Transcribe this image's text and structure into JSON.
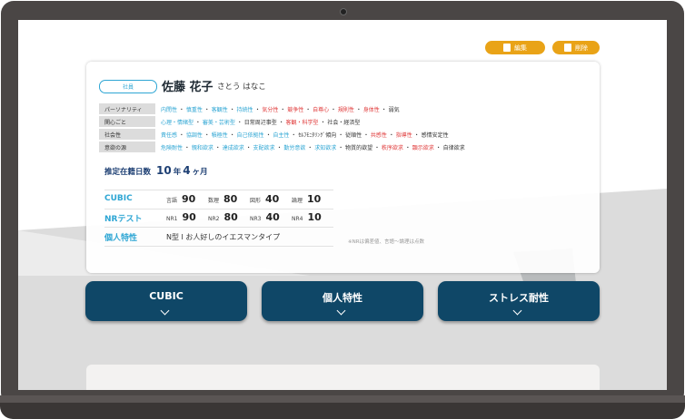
{
  "toolbar": {
    "edit_label": "編集",
    "delete_label": "削除"
  },
  "employee": {
    "badge": "社員",
    "name": "佐藤 花子",
    "kana": "さとう はなこ"
  },
  "tags": [
    {
      "label": "パーソナリティ",
      "values": [
        {
          "text": "内閉性",
          "color": "blue"
        },
        {
          "text": "慎重性",
          "color": "blue"
        },
        {
          "text": "客観性",
          "color": "blue"
        },
        {
          "text": "持続性",
          "color": "blue"
        },
        {
          "text": "気分性",
          "color": "red"
        },
        {
          "text": "競争性",
          "color": "red"
        },
        {
          "text": "自尊心",
          "color": "red"
        },
        {
          "text": "規則性",
          "color": "red"
        },
        {
          "text": "身体性",
          "color": "red"
        },
        {
          "text": "弱気",
          "color": "dark"
        }
      ]
    },
    {
      "label": "関心ごと",
      "values": [
        {
          "text": "心理・情緒型",
          "color": "blue"
        },
        {
          "text": "審美・芸術型",
          "color": "blue"
        },
        {
          "text": "日常周辺事型",
          "color": "dark"
        },
        {
          "text": "客観・科学型",
          "color": "red"
        },
        {
          "text": "社会・経済型",
          "color": "dark"
        }
      ]
    },
    {
      "label": "社会性",
      "values": [
        {
          "text": "責任感",
          "color": "blue"
        },
        {
          "text": "協調性",
          "color": "blue"
        },
        {
          "text": "積極性",
          "color": "blue"
        },
        {
          "text": "自己依拠性",
          "color": "blue"
        },
        {
          "text": "自主性",
          "color": "blue"
        },
        {
          "text": "ｾﾙﾌﾓﾆﾀﾘﾝｸﾞ傾向",
          "color": "dark"
        },
        {
          "text": "従順性",
          "color": "dark"
        },
        {
          "text": "共感性",
          "color": "red"
        },
        {
          "text": "指導性",
          "color": "red"
        },
        {
          "text": "感情安定性",
          "color": "dark"
        }
      ]
    },
    {
      "label": "意欲の源",
      "values": [
        {
          "text": "危険耐性",
          "color": "blue"
        },
        {
          "text": "親和欲求",
          "color": "blue"
        },
        {
          "text": "達成欲求",
          "color": "blue"
        },
        {
          "text": "支配欲求",
          "color": "blue"
        },
        {
          "text": "勤労意欲",
          "color": "blue"
        },
        {
          "text": "求知欲求",
          "color": "blue"
        },
        {
          "text": "物質的欲望",
          "color": "dark"
        },
        {
          "text": "秩序欲求",
          "color": "red"
        },
        {
          "text": "顕示欲求",
          "color": "red"
        },
        {
          "text": "自律欲求",
          "color": "dark"
        }
      ]
    }
  ],
  "tenure": {
    "label": "推定在籍日数",
    "years": "10",
    "years_unit": "年",
    "months": "4",
    "months_unit": "ヶ月"
  },
  "cubic": {
    "title": "CUBIC",
    "items": [
      {
        "label": "言語",
        "value": "90"
      },
      {
        "label": "数理",
        "value": "80"
      },
      {
        "label": "図形",
        "value": "40"
      },
      {
        "label": "論理",
        "value": "10"
      }
    ]
  },
  "nr": {
    "title": "NRテスト",
    "items": [
      {
        "label": "NR1",
        "value": "90"
      },
      {
        "label": "NR2",
        "value": "80"
      },
      {
        "label": "NR3",
        "value": "40"
      },
      {
        "label": "NR4",
        "value": "10"
      }
    ]
  },
  "trait": {
    "title": "個人特性",
    "value": "N型 I お人好しのイエスマンタイプ"
  },
  "note": "※NRは偏差値、言語〜論理は点数",
  "accordions": [
    {
      "label": "CUBIC"
    },
    {
      "label": "個人特性"
    },
    {
      "label": "ストレス耐性"
    }
  ],
  "colors": {
    "accent": "#e9a317",
    "navy": "#0f4767",
    "blue": "#2ea6d4",
    "red": "#e03a3a",
    "dark": "#333333"
  }
}
